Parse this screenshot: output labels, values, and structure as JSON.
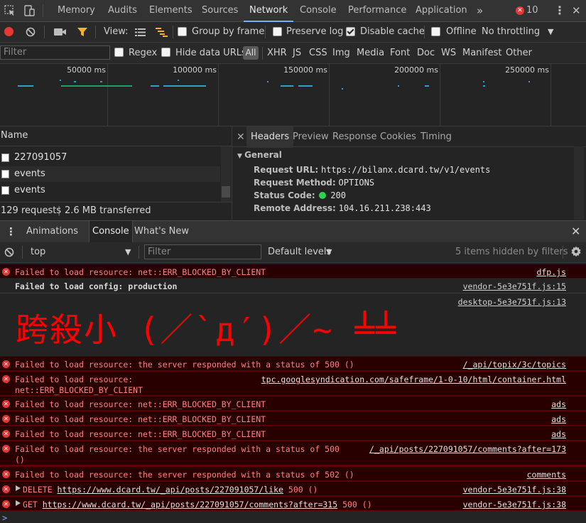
{
  "tabbar": {
    "tabs": [
      "Memory",
      "Audits",
      "Elements",
      "Sources",
      "Network",
      "Console",
      "Performance",
      "Application"
    ],
    "active": "Network",
    "more": "»",
    "error_count": "10"
  },
  "toolbar": {
    "view_label": "View:",
    "group_by_frame": "Group by frame",
    "preserve_log": "Preserve log",
    "disable_cache": "Disable cache",
    "offline": "Offline",
    "throttling": "No throttling"
  },
  "filterbar": {
    "placeholder": "Filter",
    "regex": "Regex",
    "hide_data_urls": "Hide data URLs",
    "all": "All",
    "types": [
      "XHR",
      "JS",
      "CSS",
      "Img",
      "Media",
      "Font",
      "Doc",
      "WS",
      "Manifest",
      "Other"
    ]
  },
  "overview": {
    "ticks": [
      "50000 ms",
      "100000 ms",
      "150000 ms",
      "200000 ms",
      "250000 ms"
    ]
  },
  "requests": {
    "header": "Name",
    "rows": [
      "227091057",
      "events",
      "events"
    ],
    "status": "129 requests",
    "transferred": "2.6 MB transferred"
  },
  "details": {
    "tabs": [
      "Headers",
      "Preview",
      "Response",
      "Cookies",
      "Timing"
    ],
    "active": "Headers",
    "section": "General",
    "headers": [
      {
        "key": "Request URL:",
        "value": "https://bilanx.dcard.tw/v1/events"
      },
      {
        "key": "Request Method:",
        "value": "OPTIONS"
      },
      {
        "key": "Status Code:",
        "value": "200"
      },
      {
        "key": "Remote Address:",
        "value": "104.16.211.238:443"
      }
    ]
  },
  "drawer": {
    "tabs": [
      "Animations",
      "Console",
      "What's New"
    ],
    "active": "Console"
  },
  "console_toolbar": {
    "context": "top",
    "filter_placeholder": "Filter",
    "levels": "Default levels",
    "hidden": "5 items hidden by filters"
  },
  "console": {
    "big_text": "跨殺小 (／`д′)／~ ╧╧",
    "messages": [
      {
        "type": "error",
        "text": "Failed to load resource: net::ERR_BLOCKED_BY_CLIENT",
        "source": "dfp.js"
      },
      {
        "type": "log",
        "text": "Failed to load config: production",
        "source": "vendor-5e3e751f.js:15"
      },
      {
        "type": "log",
        "text": "",
        "source": "desktop-5e3e751f.js:13"
      },
      {
        "type": "error",
        "text": "Failed to load resource: the server responded with a status of 500 ()",
        "source": "/_api/topix/3c/topics"
      },
      {
        "type": "error",
        "text": "Failed to load resource:",
        "text2": "net::ERR_BLOCKED_BY_CLIENT",
        "source": "tpc.googlesyndication.com/safeframe/1-0-10/html/container.html"
      },
      {
        "type": "error",
        "text": "Failed to load resource: net::ERR_BLOCKED_BY_CLIENT",
        "source": "ads"
      },
      {
        "type": "error",
        "text": "Failed to load resource: net::ERR_BLOCKED_BY_CLIENT",
        "source": "ads"
      },
      {
        "type": "error",
        "text": "Failed to load resource: net::ERR_BLOCKED_BY_CLIENT",
        "source": "ads"
      },
      {
        "type": "error",
        "text": "Failed to load resource: the server responded with a status of 500",
        "source": "/_api/posts/227091057/comments?after=173",
        "text2": "()"
      },
      {
        "type": "error",
        "text": "Failed to load resource: the server responded with a status of 502 ()",
        "source": "comments"
      },
      {
        "type": "error",
        "method": "DELETE",
        "url": "https://www.dcard.tw/_api/posts/227091057/like",
        "status": "500 ()",
        "source": "vendor-5e3e751f.js:38"
      },
      {
        "type": "error",
        "method": "GET",
        "url": "https://www.dcard.tw/_api/posts/227091057/comments?after=315",
        "status": "500 ()",
        "source": "vendor-5e3e751f.js:38"
      }
    ]
  },
  "colors": {
    "accent": "#7cacf8",
    "error_bg": "#290000",
    "error_text": "#ff8080",
    "record": "#e53935",
    "status_ok": "#2bd34f"
  }
}
